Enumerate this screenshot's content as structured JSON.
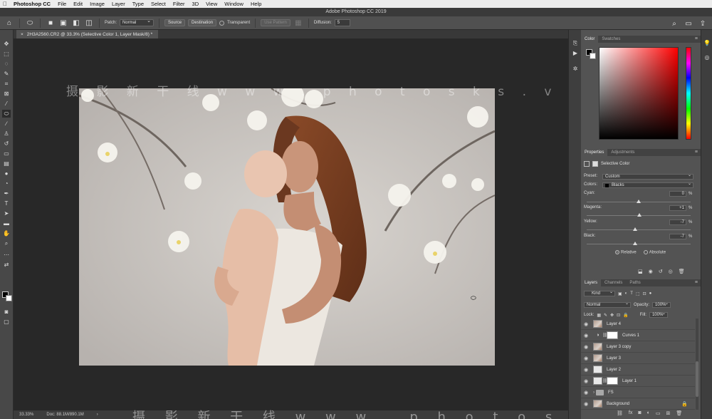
{
  "menubar": {
    "apple": "",
    "app_name": "Photoshop CC",
    "items": [
      "File",
      "Edit",
      "Image",
      "Layer",
      "Type",
      "Select",
      "Filter",
      "3D",
      "View",
      "Window",
      "Help"
    ]
  },
  "window": {
    "title": "Adobe Photoshop CC 2019"
  },
  "options_bar": {
    "patch_label": "Patch:",
    "patch_value": "Normal",
    "source_label": "Source",
    "destination_label": "Destination",
    "transparent_label": "Transparent",
    "use_pattern_label": "Use Pattern",
    "diffusion_label": "Diffusion:",
    "diffusion_value": "5"
  },
  "document": {
    "tab_title": "2H3A2560.CR2 @ 33.3% (Selective Color 1, Layer Mask/8) *",
    "watermark": "摄 影 新 干 线   w w w . p h o t o s k s . v i p"
  },
  "status": {
    "zoom": "33.33%",
    "doc_info": "Doc: 88.1M/890.1M",
    "watermark": "摄 影 新 干 线   w w w . p h o t o s k s . v i p"
  },
  "color_panel": {
    "tabs": [
      "Color",
      "Swatches"
    ],
    "active_tab": "Color",
    "foreground": "#000000",
    "background": "#ffffff",
    "hue": "#ff0000"
  },
  "properties_panel": {
    "tabs": [
      "Properties",
      "Adjustments"
    ],
    "title": "Selective Color",
    "preset_label": "Preset:",
    "preset_value": "Custom",
    "colors_label": "Colors:",
    "colors_value": "Blacks",
    "sliders": [
      {
        "label": "Cyan:",
        "value": "0",
        "pct": "%",
        "fraction": 0.5
      },
      {
        "label": "Magenta:",
        "value": "+1",
        "pct": "%",
        "fraction": 0.505
      },
      {
        "label": "Yellow:",
        "value": "-7",
        "pct": "%",
        "fraction": 0.465
      },
      {
        "label": "Black:",
        "value": "-7",
        "pct": "%",
        "fraction": 0.465
      }
    ],
    "method_relative": "Relative",
    "method_absolute": "Absolute"
  },
  "layers_panel": {
    "tabs": [
      "Layers",
      "Channels",
      "Paths"
    ],
    "filter_value": "Kind",
    "blend_mode": "Normal",
    "opacity_label": "Opacity:",
    "opacity_value": "100%",
    "lock_label": "Lock:",
    "fill_label": "Fill:",
    "fill_value": "100%",
    "layers": [
      {
        "name": "Layer 4",
        "kind": "photo"
      },
      {
        "name": "Curves 1",
        "kind": "adjustment"
      },
      {
        "name": "Layer 3 copy",
        "kind": "photo"
      },
      {
        "name": "Layer 3",
        "kind": "photo"
      },
      {
        "name": "Layer 2",
        "kind": "blank"
      },
      {
        "name": "Layer 1",
        "kind": "masked"
      },
      {
        "name": "FS",
        "kind": "group"
      },
      {
        "name": "Background",
        "kind": "background"
      }
    ]
  }
}
